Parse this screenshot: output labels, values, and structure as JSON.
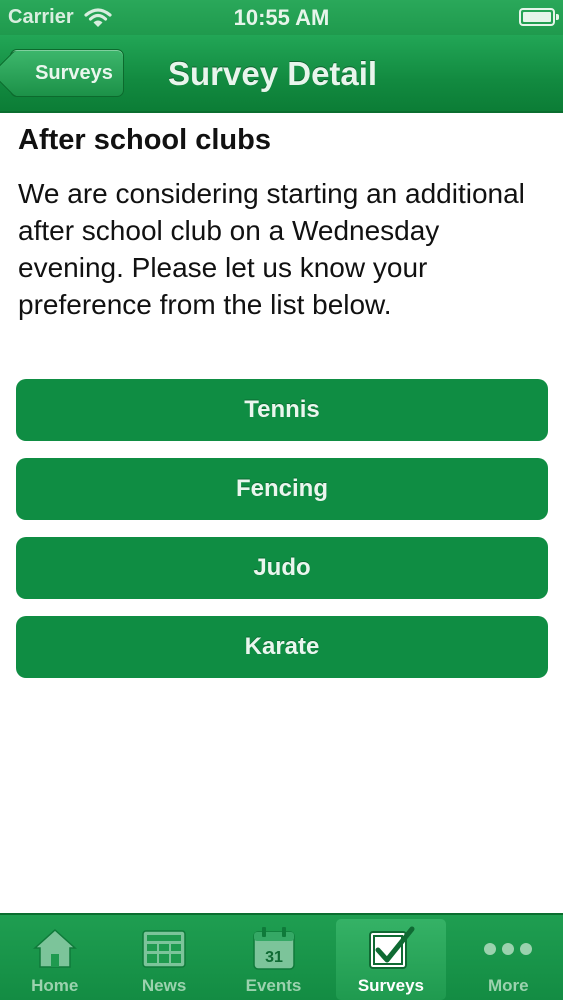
{
  "status_bar": {
    "carrier": "Carrier",
    "time": "10:55 AM"
  },
  "nav": {
    "back_label": "Surveys",
    "title": "Survey Detail"
  },
  "survey": {
    "title": "After school clubs",
    "description": "We are considering starting an additional after school club on a Wednesday evening. Please let us know your preference from the list below.",
    "options": [
      "Tennis",
      "Fencing",
      "Judo",
      "Karate"
    ]
  },
  "tab_bar": {
    "active": "Surveys",
    "tabs": [
      {
        "label": "Home",
        "icon": "home-icon"
      },
      {
        "label": "News",
        "icon": "news-icon"
      },
      {
        "label": "Events",
        "icon": "calendar-icon",
        "icon_text": "31"
      },
      {
        "label": "Surveys",
        "icon": "checkbox-icon"
      },
      {
        "label": "More",
        "icon": "more-icon"
      }
    ]
  },
  "colors": {
    "brand_green": "#0f8d43",
    "nav_green": "#128a40",
    "tab_inactive_text": "#9bd2ae"
  }
}
